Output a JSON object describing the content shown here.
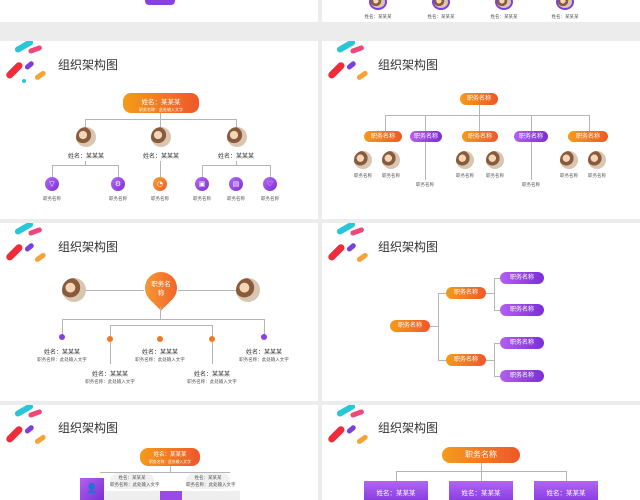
{
  "slides": {
    "title": "组织架构图",
    "name": "姓名：某某某",
    "job": "职务名称",
    "job_desc": "职务名称：此处输入文字"
  },
  "colors": {
    "orange": "#f28a1e",
    "purple": "#7b3fe0"
  }
}
